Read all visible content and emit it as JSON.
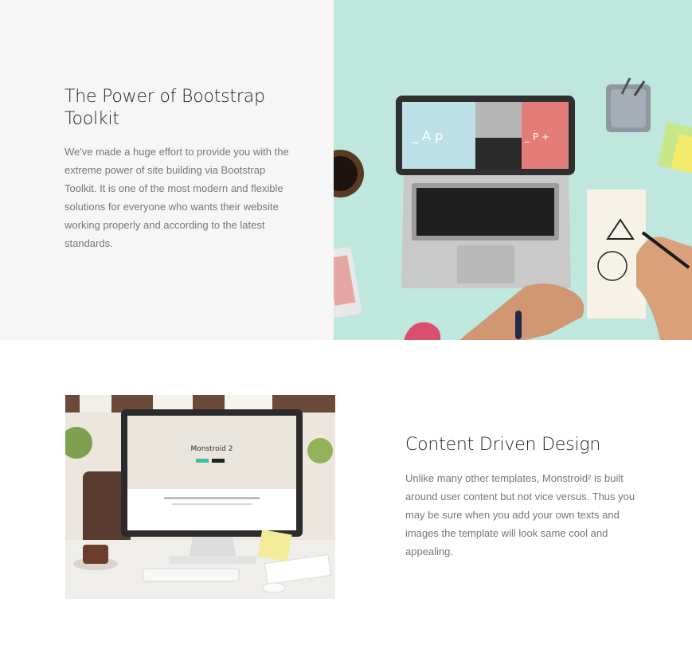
{
  "features": [
    {
      "title": "The Power of Bootstrap Toolkit",
      "body": "We've made a huge effort to provide you with the extreme power of site building via Bootstrap Toolkit. It is one of the most modern and flexible solutions for everyone who wants their website working properly and according to the latest standards.",
      "image": {
        "icon": "laptop-workspace-photo",
        "screen_text_a": "_ A p",
        "screen_text_b": "_ P +"
      }
    },
    {
      "title": "Content Driven Design",
      "body": "Unlike many other templates, Monstroid² is built around user content but not vice versus. Thus you may be sure when you add your own texts and images the template will look same cool and appealing.",
      "image": {
        "icon": "desktop-workspace-photo",
        "screen_title": "Monstroid 2"
      }
    }
  ],
  "colors": {
    "section_bg": "#f6f6f6",
    "photo_bg": "#bfe7dd",
    "heading": "#222222",
    "body_text": "#777777"
  }
}
